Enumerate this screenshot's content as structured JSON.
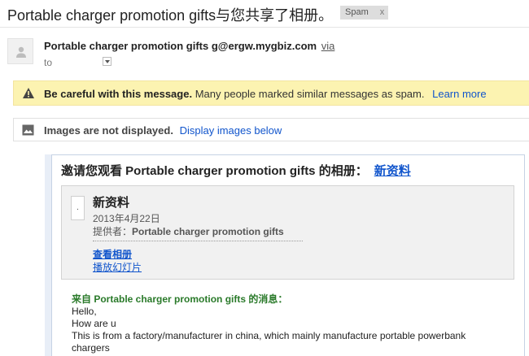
{
  "subject": {
    "title": "Portable charger promotion gifts与您共享了相册。",
    "label": "Spam",
    "label_close": "x"
  },
  "sender": {
    "avatar_icon": "person-icon",
    "name": "Portable charger promotion gifts g@ergw.mygbiz.com",
    "via": "via",
    "to": "to"
  },
  "warning": {
    "icon": "warning-triangle-icon",
    "bold": "Be careful with this message.",
    "text": "Many people marked similar messages as spam.",
    "learn_more": "Learn more",
    "background": "#fcf3b1"
  },
  "images_notice": {
    "icon": "image-icon",
    "bold": "Images are not displayed.",
    "link": "Display images below"
  },
  "message": {
    "invite_text": "邀请您观看 Portable charger promotion gifts 的相册：",
    "album_link": "新资料",
    "album": {
      "thumb_char": ".",
      "title": "新资料",
      "date": "2013年4月22日",
      "provider_prefix": "提供者：",
      "provider_name": "Portable charger promotion gifts",
      "view_album": "查看相册",
      "slideshow": "播放幻灯片"
    },
    "from_label": "来自 Portable charger promotion gifts 的消息：",
    "body": [
      "Hello,",
      "How are u",
      "This is from a factory/manufacturer in china, which mainly manufacture portable powerbank",
      "chargers"
    ]
  },
  "colors": {
    "link": "#1155cc",
    "from_green": "#2a7a2a"
  }
}
